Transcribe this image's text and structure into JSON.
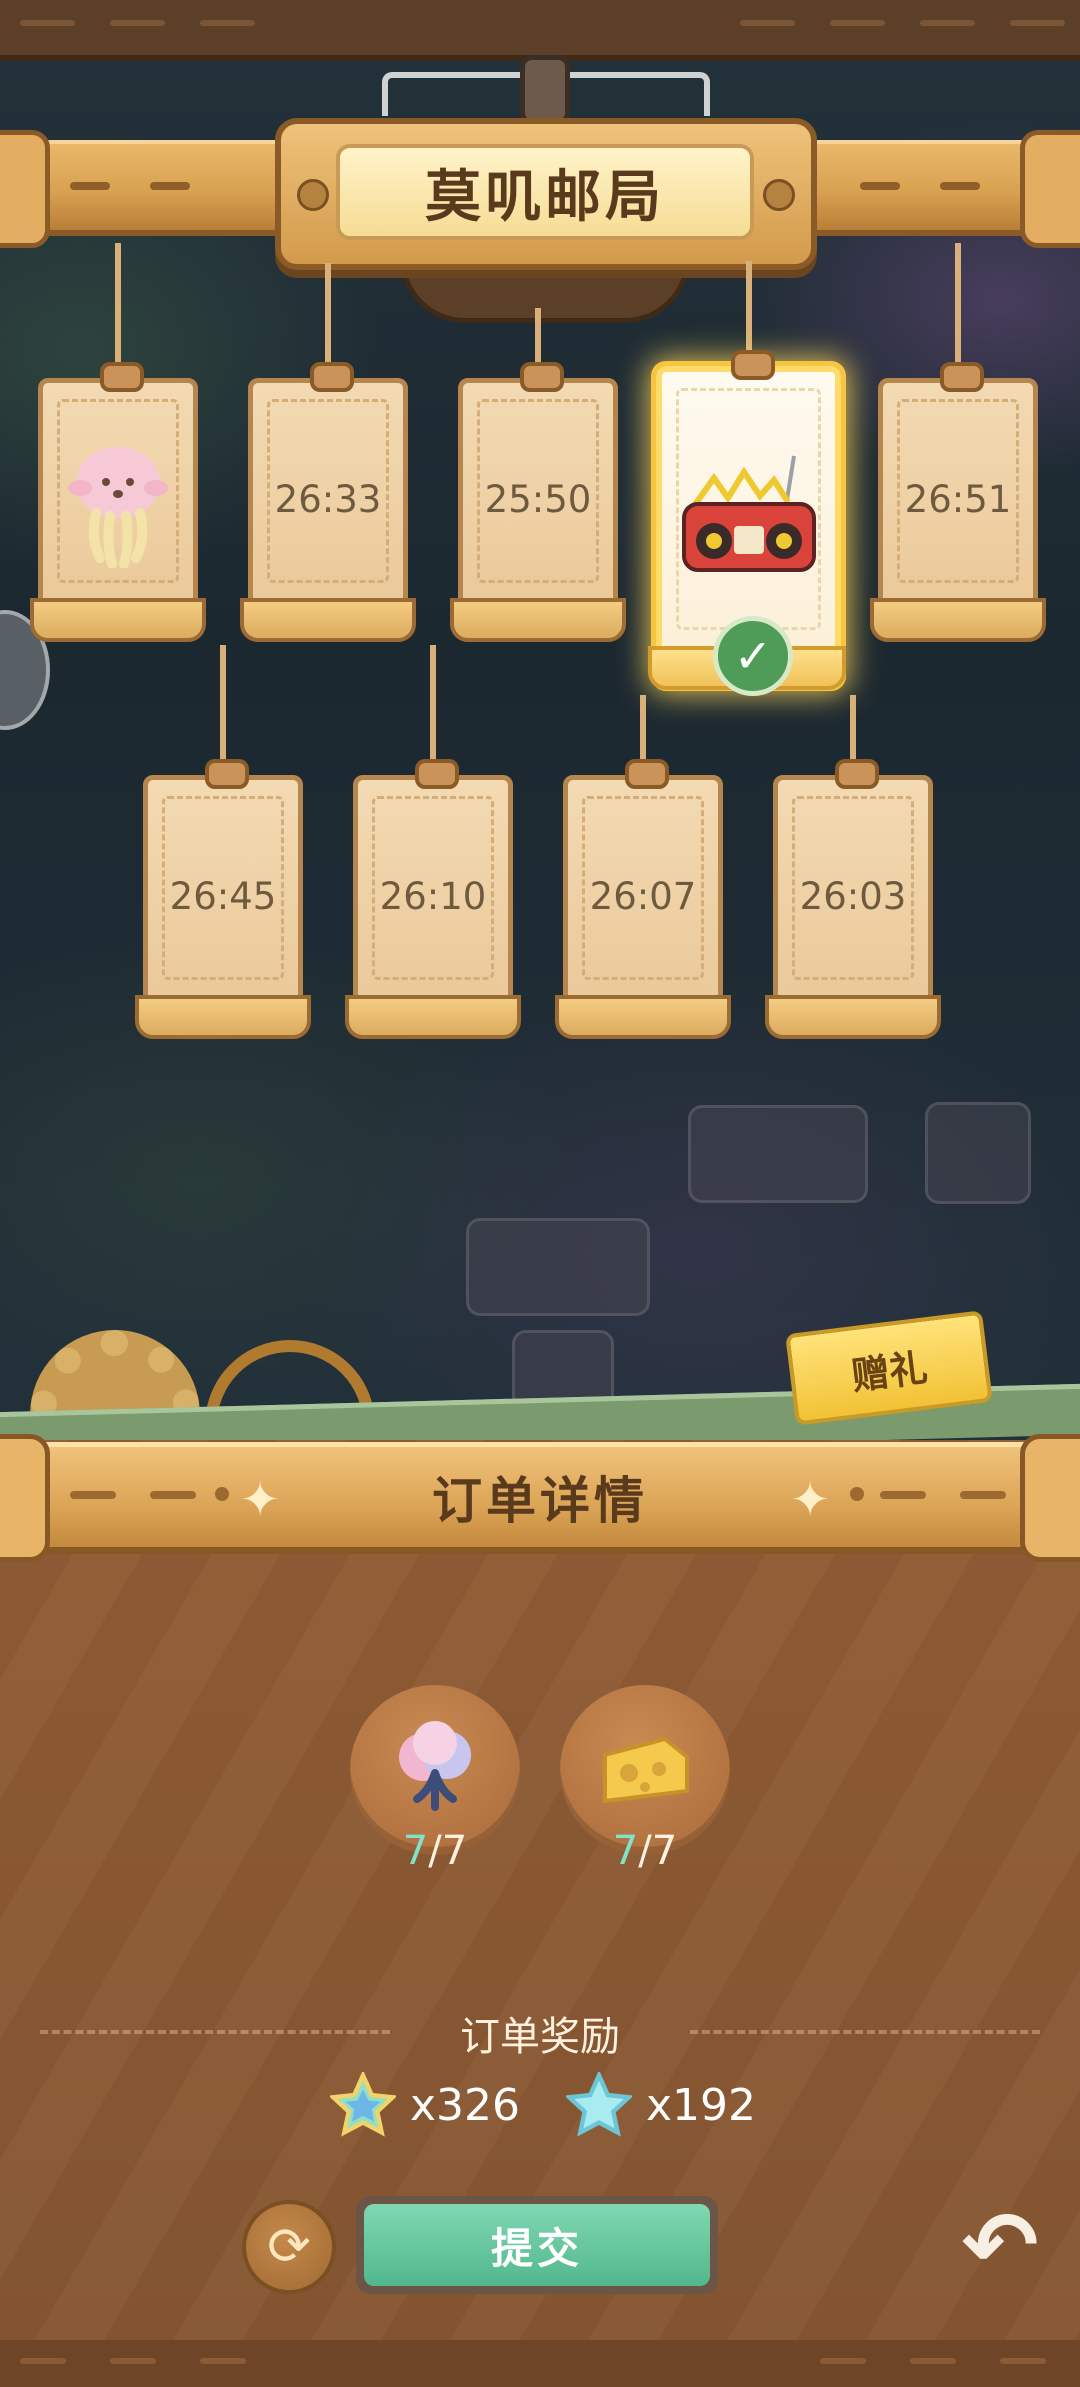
{
  "header": {
    "title": "莫叽邮局"
  },
  "orders": [
    {
      "state": "item",
      "icon": "jellyfish-icon"
    },
    {
      "state": "timer",
      "time": "26:33"
    },
    {
      "state": "timer",
      "time": "25:50"
    },
    {
      "state": "selected",
      "icon": "radio-icon",
      "done": true
    },
    {
      "state": "timer",
      "time": "26:51"
    },
    {
      "state": "timer",
      "time": "26:45"
    },
    {
      "state": "timer",
      "time": "26:10"
    },
    {
      "state": "timer",
      "time": "26:07"
    },
    {
      "state": "timer",
      "time": "26:03"
    }
  ],
  "gift_button": {
    "label": "赠礼"
  },
  "details": {
    "title": "订单详情",
    "items": [
      {
        "icon": "cotton-flower-icon",
        "have": "7",
        "need": "/7"
      },
      {
        "icon": "cheese-icon",
        "have": "7",
        "need": "/7"
      }
    ]
  },
  "rewards": {
    "title": "订单奖励",
    "items": [
      {
        "icon": "rainbow-star-icon",
        "amount": "x326"
      },
      {
        "icon": "blue-star-icon",
        "amount": "x192"
      }
    ]
  },
  "actions": {
    "submit_label": "提交"
  },
  "colors": {
    "accent": "#52b78d",
    "selected_glow": "#f7c53f",
    "panel": "#8f5c34",
    "rail": "#dba456"
  }
}
